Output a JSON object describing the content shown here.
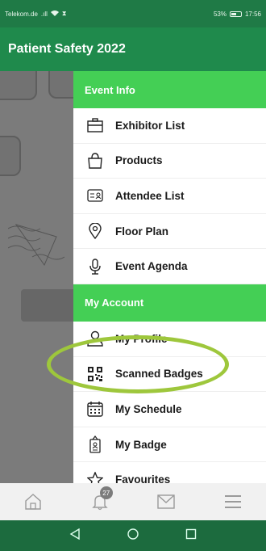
{
  "status_bar": {
    "carrier": "Telekom.de",
    "signal": ".ıll",
    "battery": "53%",
    "time": "17:56"
  },
  "app": {
    "title": "Patient Safety 2022"
  },
  "drawer": {
    "event_info": {
      "header": "Event Info",
      "items": [
        {
          "label": "Exhibitor List",
          "icon": "exhibitor-icon"
        },
        {
          "label": "Products",
          "icon": "bag-icon"
        },
        {
          "label": "Attendee List",
          "icon": "id-card-icon"
        },
        {
          "label": "Floor Plan",
          "icon": "pin-icon"
        },
        {
          "label": "Event Agenda",
          "icon": "microphone-icon"
        }
      ]
    },
    "my_account": {
      "header": "My Account",
      "items": [
        {
          "label": "My Profile",
          "icon": "person-icon"
        },
        {
          "label": "Scanned Badges",
          "icon": "qr-code-icon"
        },
        {
          "label": "My Schedule",
          "icon": "calendar-icon"
        },
        {
          "label": "My Badge",
          "icon": "badge-icon"
        },
        {
          "label": "Favourites",
          "icon": "star-icon"
        }
      ]
    }
  },
  "bottom_nav": {
    "notification_count": "27"
  },
  "colors": {
    "status_bar": "#1f7a46",
    "header": "#1f8a4c",
    "section": "#44cf55",
    "highlight": "#9ec73c"
  }
}
